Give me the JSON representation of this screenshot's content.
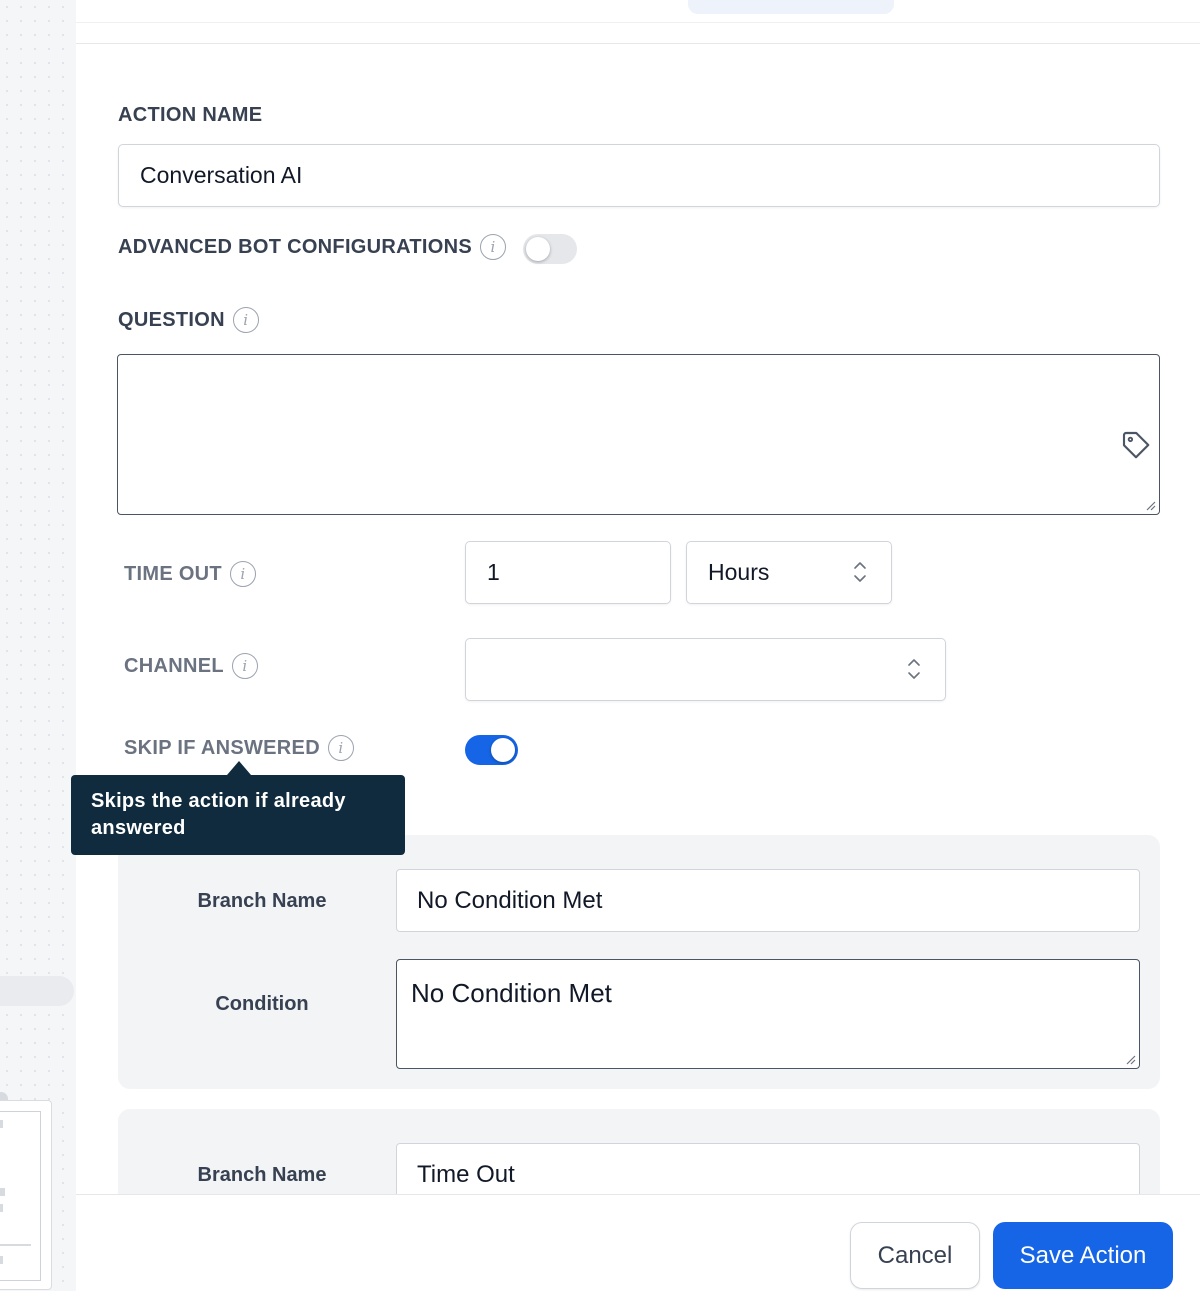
{
  "form": {
    "action_name_label": "ACTION NAME",
    "action_name_value": "Conversation AI",
    "advanced_label": "ADVANCED BOT CONFIGURATIONS",
    "advanced_enabled": false,
    "question_label": "QUESTION",
    "question_value": "",
    "timeout_label": "TIME OUT",
    "timeout_value": "1",
    "timeout_unit": "Hours",
    "channel_label": "CHANNEL",
    "channel_value": "",
    "skip_label": "SKIP IF ANSWERED",
    "skip_enabled": true,
    "tooltip_text": "Skips the action if already answered"
  },
  "branches": [
    {
      "name_label": "Branch Name",
      "name_value": "No Condition Met",
      "condition_label": "Condition",
      "condition_value": "No Condition Met"
    },
    {
      "name_label": "Branch Name",
      "name_value": "Time Out"
    }
  ],
  "footer": {
    "cancel_label": "Cancel",
    "save_label": "Save Action"
  },
  "colors": {
    "primary": "#1565e6",
    "tooltip_bg": "#0f2b3d",
    "toggle_off": "#e5e7eb"
  },
  "icons": {
    "info": "info-icon",
    "tag": "tag-icon",
    "select": "chevron-up-down-icon"
  }
}
